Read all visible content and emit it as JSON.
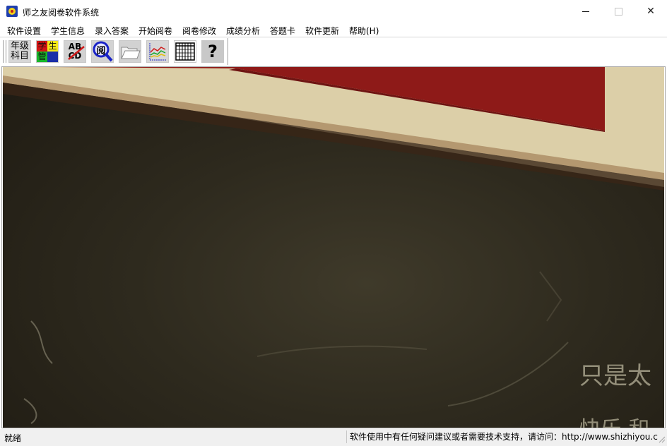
{
  "window": {
    "title": "师之友阅卷软件系统",
    "close_symbol": "✕"
  },
  "menu": [
    "软件设置",
    "学生信息",
    "录入答案",
    "开始阅卷",
    "阅卷修改",
    "成绩分析",
    "答题卡",
    "软件更新",
    "帮助(H)"
  ],
  "toolbar": {
    "buttons": [
      {
        "name": "grade-subject",
        "lines": [
          "年级",
          "科目"
        ]
      },
      {
        "name": "student-management",
        "glyphs": [
          "学",
          "生",
          "管"
        ]
      },
      {
        "name": "answer-entry",
        "glyphs": [
          "AB",
          "CD"
        ]
      },
      {
        "name": "start-marking",
        "glyph": "阅"
      },
      {
        "name": "open-folder"
      },
      {
        "name": "score-analysis-chart"
      },
      {
        "name": "answer-sheet-table"
      },
      {
        "name": "help",
        "glyph": "?"
      }
    ]
  },
  "content": {
    "chalk_text_1": "只是太",
    "chalk_text_2": "快乐 和"
  },
  "status": {
    "left": "就绪",
    "right": "软件使用中有任何疑问建议或者需要技术支持，请访问：http://www.shizhiyou.com"
  },
  "colors": {
    "title_bg": "#ffffff",
    "statusbar_bg": "#f0f0f0",
    "chalkboard": "#2e2a1e",
    "board_red": "#8c1a18",
    "board_frame": "#d9cfad"
  }
}
